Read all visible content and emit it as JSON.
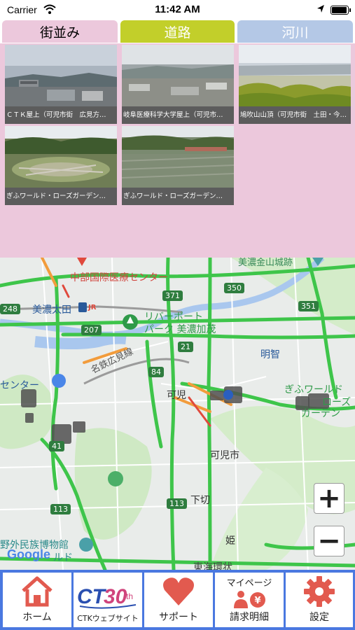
{
  "status_bar": {
    "carrier": "Carrier",
    "time": "11:42 AM"
  },
  "tabs": [
    {
      "label": "街並み",
      "color": "#ecc8dc"
    },
    {
      "label": "道路",
      "color": "#c2cf2a"
    },
    {
      "label": "河川",
      "color": "#b4c8e6"
    }
  ],
  "cameras": [
    {
      "caption": "ＣＴＫ屋上（可児市街　広見方…"
    },
    {
      "caption": "岐阜医療科学大学屋上（可児市…"
    },
    {
      "caption": "鳩吹山山頂（可児市街　土田・今…"
    },
    {
      "caption": "ぎふワールド・ローズガーデン…"
    },
    {
      "caption": "ぎふワールド・ローズガーデン…"
    }
  ],
  "map": {
    "labels": {
      "chubu": "中部国際医療センター",
      "minoota": "美濃太田",
      "riverport1": "リバーポート",
      "riverport2": "パーク 美濃加茂",
      "meitetsu": "名鉄広見線",
      "kani": "可児",
      "kanishi": "可児市",
      "shimogiri": "下切",
      "hime": "姫",
      "akechi": "明智",
      "gifuworld1": "ぎふワールド",
      "gifuworld2": "ローズ",
      "gifuworld3": "ガーデン",
      "center": "センター",
      "museum": "野外民族博物館",
      "minokanayama": "美濃金山城跡",
      "higashi": "東海環状",
      "google": "Google",
      "ld": "ルド",
      "jr": "JR"
    },
    "routes": [
      "350",
      "371",
      "248",
      "207",
      "351",
      "21",
      "84",
      "41",
      "113",
      "113"
    ],
    "zoom_in": "+",
    "zoom_out": "−"
  },
  "bottom_nav": [
    {
      "label": "ホーム"
    },
    {
      "label": "CTKウェブサイト",
      "logo": "CTK30th"
    },
    {
      "label": "サポート"
    },
    {
      "label": "請求明細",
      "top": "マイページ"
    },
    {
      "label": "設定"
    }
  ],
  "colors": {
    "accent_red": "#e25a4f",
    "nav_bg": "#4a78e0",
    "road_green": "#3ec54a"
  }
}
